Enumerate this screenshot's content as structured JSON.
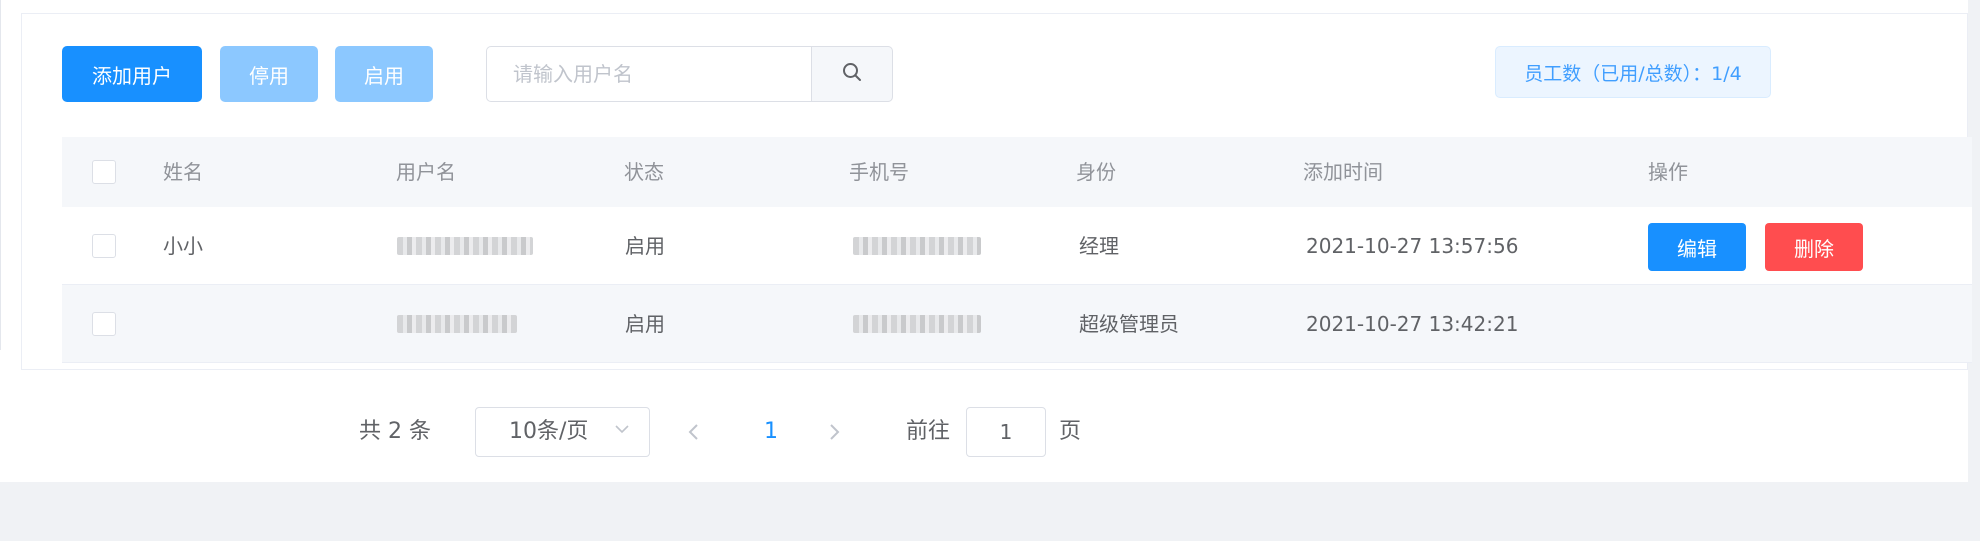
{
  "toolbar": {
    "add_label": "添加用户",
    "disable_label": "停用",
    "enable_label": "启用",
    "search_placeholder": "请输入用户名",
    "search_value": "",
    "employee_count_label": "员工数（已用/总数）：1/4"
  },
  "table": {
    "headers": [
      "姓名",
      "用户名",
      "状态",
      "手机号",
      "身份",
      "添加时间",
      "操作"
    ],
    "rows": [
      {
        "name": "小小",
        "status": "启用",
        "role": "经理",
        "added_time": "2021-10-27 13:57:56",
        "actions": [
          "编辑",
          "删除"
        ]
      },
      {
        "name": "",
        "status": "启用",
        "role": "超级管理员",
        "added_time": "2021-10-27 13:42:21",
        "actions": []
      }
    ]
  },
  "pagination": {
    "total_label": "共 2 条",
    "page_size_label": "10条/页",
    "current_page": "1",
    "goto_label": "前往",
    "goto_value": "1",
    "page_suffix": "页"
  },
  "colors": {
    "primary": "#1890ff",
    "primary_light": "#8cc8ff",
    "danger": "#ff4d4f",
    "tag_bg": "#ecf5ff",
    "tag_text": "#409eff"
  },
  "icons": {
    "search": "search-icon",
    "select_arrow": "chevron-down-icon",
    "prev": "chevron-left-icon",
    "next": "chevron-right-icon"
  }
}
